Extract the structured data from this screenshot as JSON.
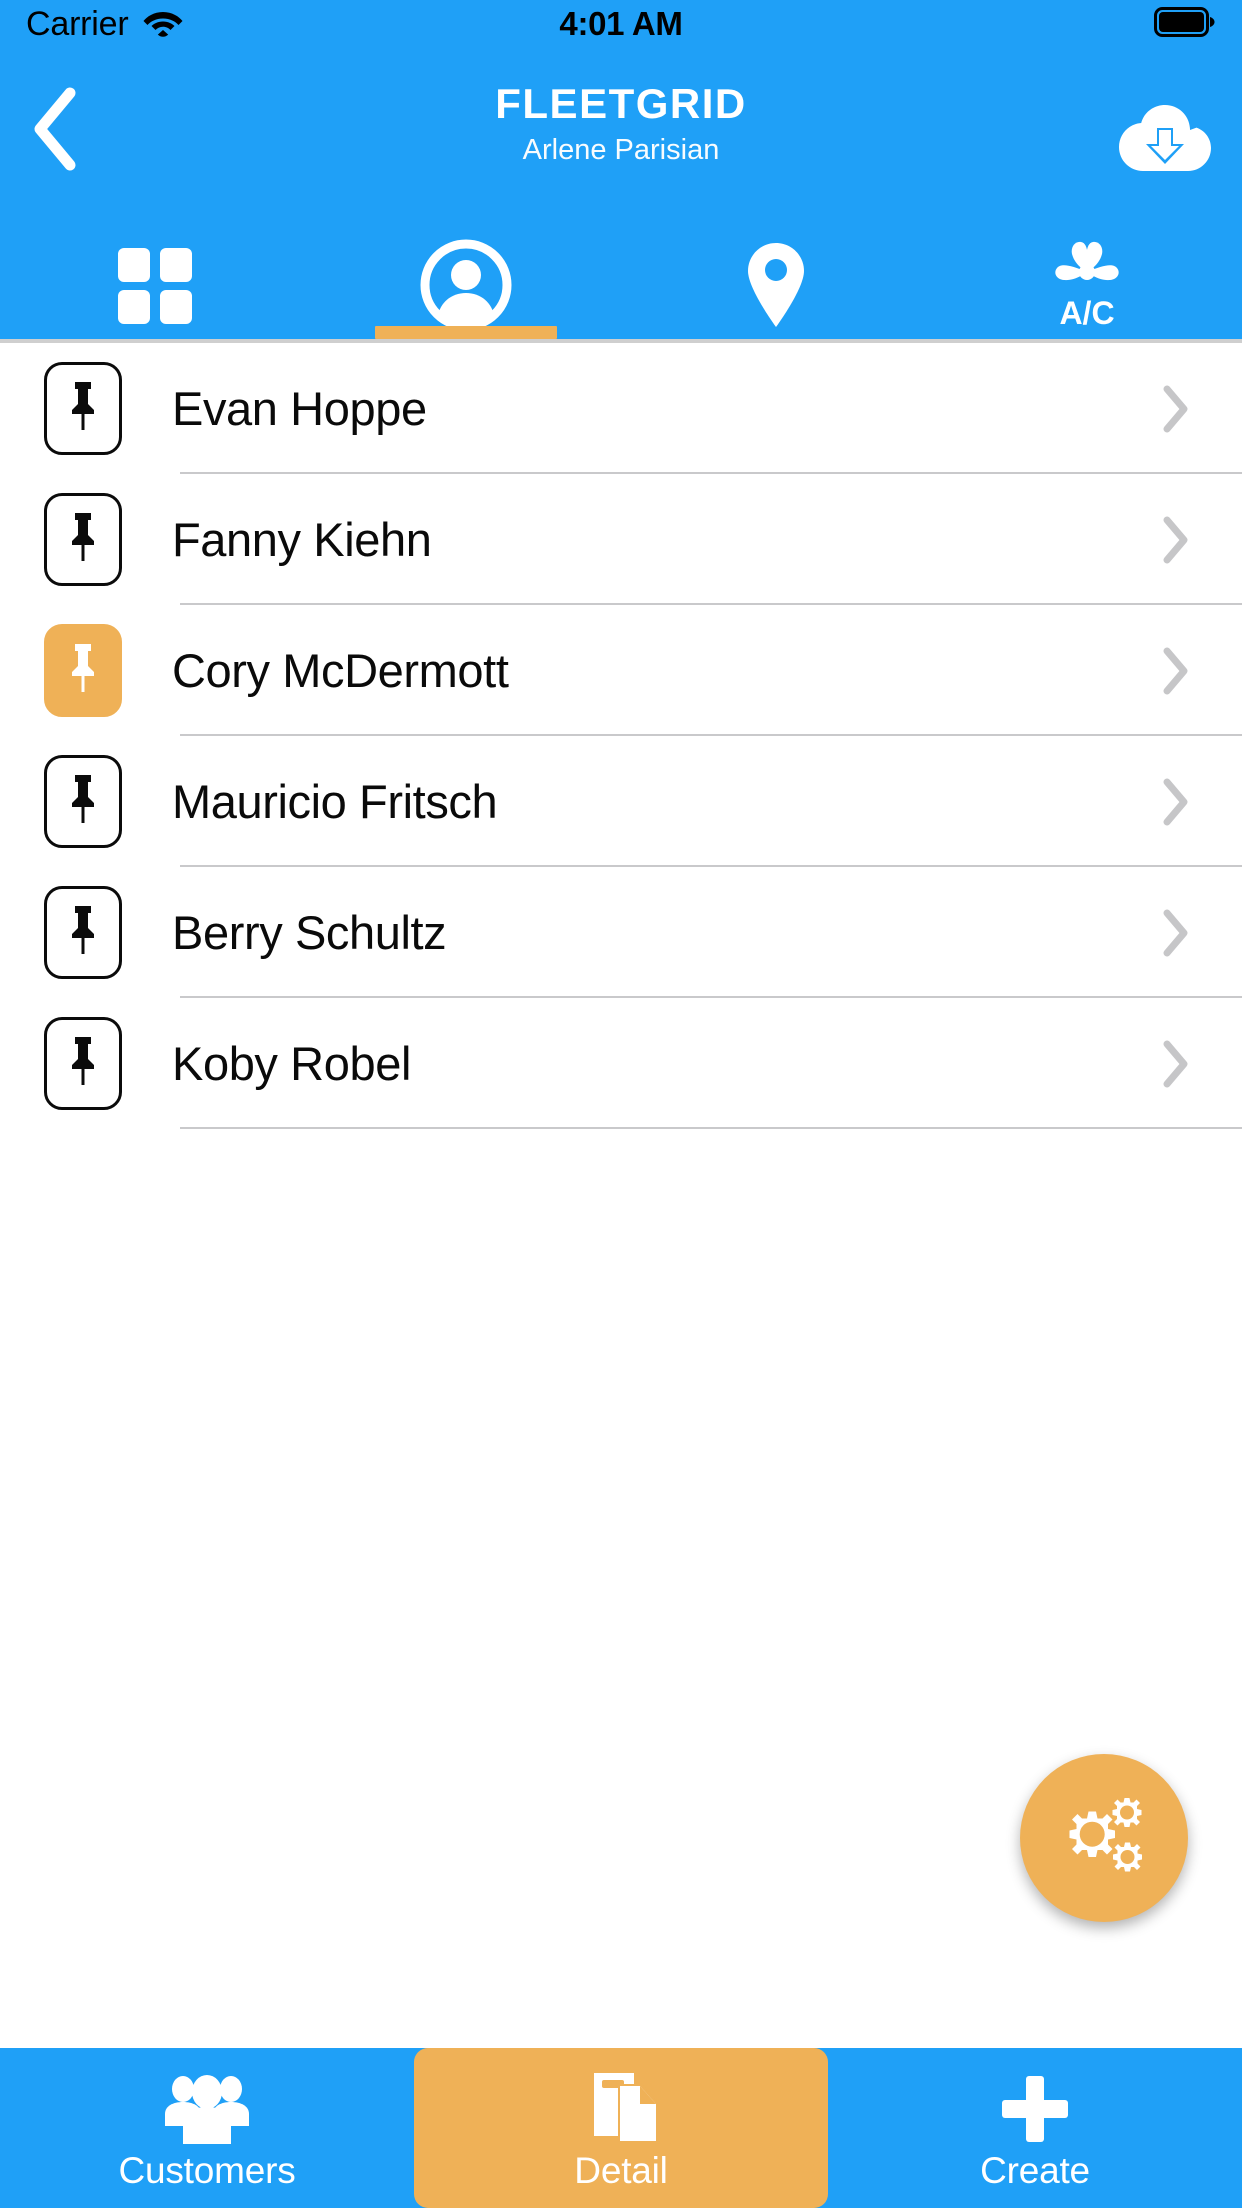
{
  "status_bar": {
    "carrier": "Carrier",
    "time": "4:01 AM",
    "wifi_icon": "wifi-icon",
    "battery_icon": "battery-full-icon"
  },
  "nav": {
    "title": "FLEETGRID",
    "subtitle": "Arlene Parisian",
    "back_icon": "chevron-left-icon",
    "download_icon": "cloud-download-icon"
  },
  "segment_tabs": [
    {
      "name": "grid",
      "icon": "grid-icon",
      "selected": false
    },
    {
      "name": "customer",
      "icon": "person-icon",
      "selected": true
    },
    {
      "name": "location",
      "icon": "map-pin-icon",
      "selected": false
    },
    {
      "name": "ac",
      "icon": "ac-fan-icon",
      "label": "A/C",
      "selected": false
    }
  ],
  "list": {
    "rows": [
      {
        "name": "Evan Hoppe",
        "pinned": false,
        "pin_icon": "pushpin-icon",
        "chevron_icon": "chevron-right-icon"
      },
      {
        "name": "Fanny Kiehn",
        "pinned": false,
        "pin_icon": "pushpin-icon",
        "chevron_icon": "chevron-right-icon"
      },
      {
        "name": "Cory McDermott",
        "pinned": true,
        "pin_icon": "pushpin-icon",
        "chevron_icon": "chevron-right-icon"
      },
      {
        "name": "Mauricio Fritsch",
        "pinned": false,
        "pin_icon": "pushpin-icon",
        "chevron_icon": "chevron-right-icon"
      },
      {
        "name": "Berry Schultz",
        "pinned": false,
        "pin_icon": "pushpin-icon",
        "chevron_icon": "chevron-right-icon"
      },
      {
        "name": "Koby Robel",
        "pinned": false,
        "pin_icon": "pushpin-icon",
        "chevron_icon": "chevron-right-icon"
      }
    ]
  },
  "fab": {
    "icon": "gears-icon"
  },
  "bottom_bar": {
    "items": [
      {
        "label": "Customers",
        "icon": "people-group-icon",
        "active": false
      },
      {
        "label": "Detail",
        "icon": "documents-icon",
        "active": true
      },
      {
        "label": "Create",
        "icon": "plus-icon",
        "active": false
      }
    ]
  },
  "colors": {
    "brand_blue": "#1fa0f7",
    "accent_orange": "#efb157",
    "separator": "#c9c9cb",
    "chevron_gray": "#c6c6c8",
    "text_dark": "#0a0a0a",
    "white": "#ffffff"
  }
}
